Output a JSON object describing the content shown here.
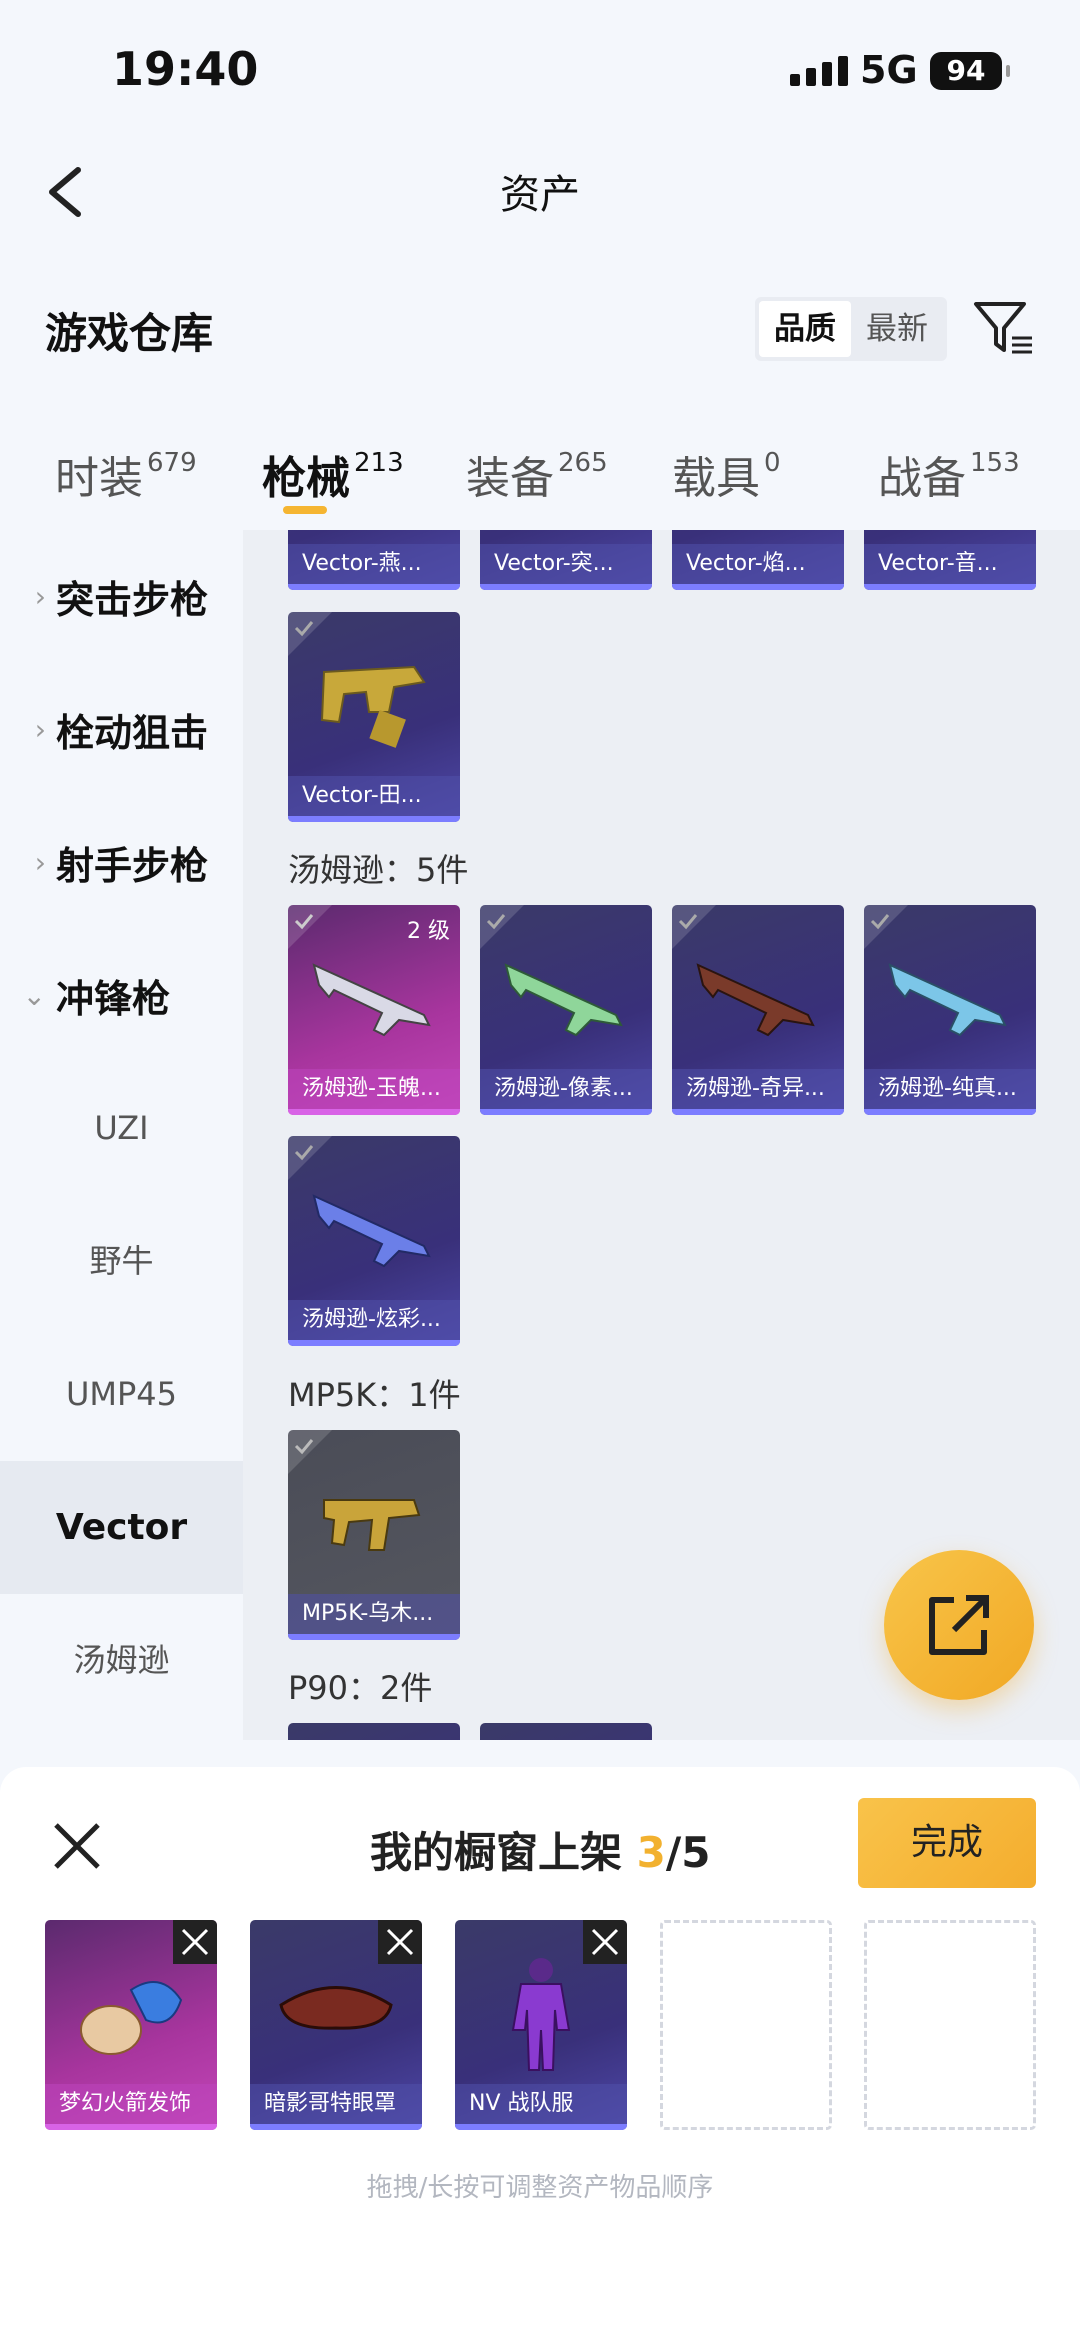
{
  "status": {
    "time": "19:40",
    "network": "5G",
    "battery": "94"
  },
  "nav": {
    "title": "资产"
  },
  "warehouse": {
    "title": "游戏仓库",
    "sort_quality": "品质",
    "sort_latest": "最新"
  },
  "tabs": [
    {
      "label": "时装",
      "count": "679"
    },
    {
      "label": "枪械",
      "count": "213"
    },
    {
      "label": "装备",
      "count": "265"
    },
    {
      "label": "载具",
      "count": "0"
    },
    {
      "label": "战备",
      "count": "153"
    }
  ],
  "sidebar": {
    "categories": [
      "突击步枪",
      "栓动狙击",
      "射手步枪",
      "冲锋枪"
    ],
    "subitems": [
      "UZI",
      "野牛",
      "UMP45",
      "Vector",
      "汤姆逊"
    ]
  },
  "content": {
    "vector_row_labels": [
      "Vector-燕...",
      "Vector-突...",
      "Vector-焰...",
      "Vector-音..."
    ],
    "vector_extra_label": "Vector-田...",
    "thompson_header": "汤姆逊：5件",
    "thompson": [
      {
        "label": "汤姆逊-玉魄...",
        "level": "2 级"
      },
      {
        "label": "汤姆逊-像素..."
      },
      {
        "label": "汤姆逊-奇异..."
      },
      {
        "label": "汤姆逊-纯真..."
      },
      {
        "label": "汤姆逊-炫彩..."
      }
    ],
    "mp5k_header": "MP5K：1件",
    "mp5k_label": "MP5K-乌木...",
    "p90_header": "P90：2件"
  },
  "showcase": {
    "title": "我的橱窗上架",
    "count_current": "3",
    "count_total": "/5",
    "done_label": "完成",
    "items": [
      "梦幻火箭发饰",
      "暗影哥特眼罩",
      "NV 战队服"
    ],
    "hint": "拖拽/长按可调整资产物品顺序"
  }
}
